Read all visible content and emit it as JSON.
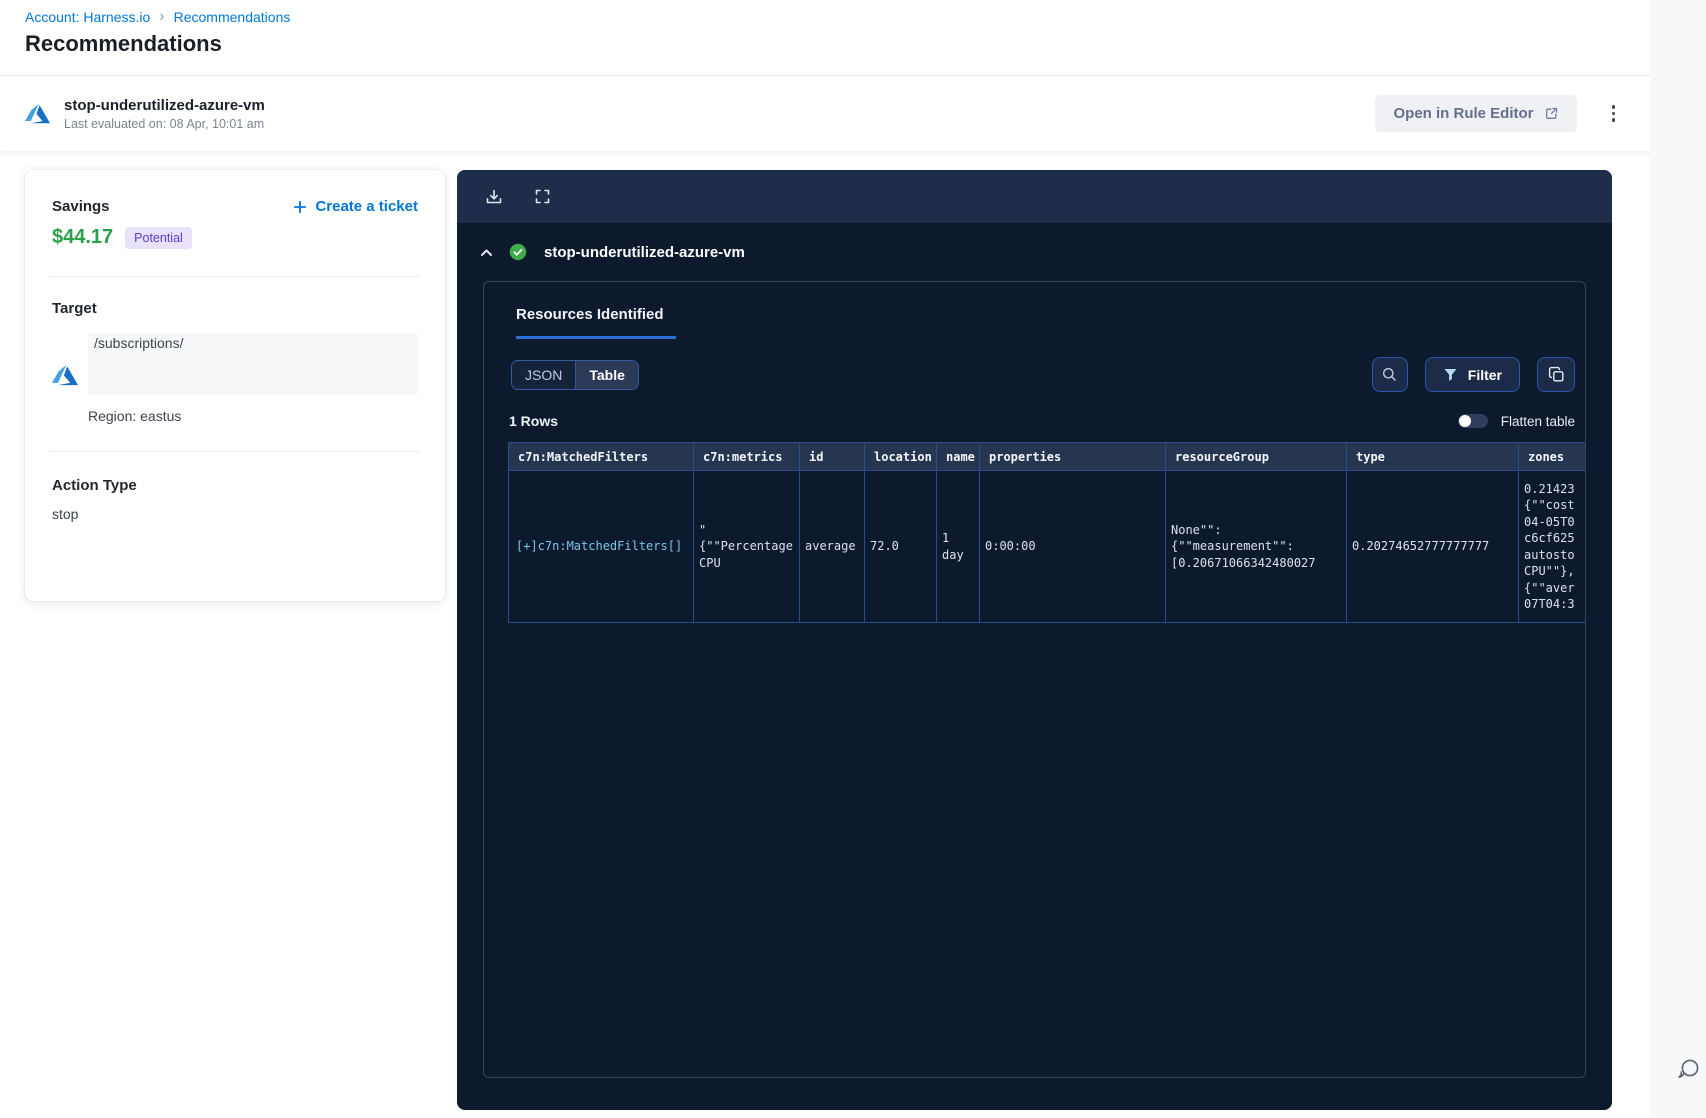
{
  "colors": {
    "accent_blue": "#0278d5",
    "savings_green": "#2aa04a",
    "badge_purple_bg": "#e8e3fb",
    "badge_purple_text": "#5c3bc9",
    "panel_bg": "#0d1a2e",
    "table_border_blue": "#2b4c8c",
    "table_link_cyan": "#7cc6e8",
    "tab_underline_blue": "#2b6fd4"
  },
  "icons": [
    "azure-icon",
    "kebab-menu-icon",
    "external-link-icon",
    "plus-icon",
    "download-icon",
    "fullscreen-icon",
    "chevron-up-icon",
    "check-circle-icon",
    "search-icon",
    "filter-funnel-icon",
    "copy-icon",
    "chat-bubble-icon",
    "breadcrumb-separator"
  ],
  "breadcrumb": {
    "account_link": "Account: Harness.io",
    "separator": "›",
    "current": "Recommendations"
  },
  "page_title": "Recommendations",
  "recommendation_header": {
    "name": "stop-underutilized-azure-vm",
    "last_evaluated": "Last evaluated on: 08 Apr, 10:01 am",
    "open_rule_editor": "Open in Rule Editor"
  },
  "summary_card": {
    "savings_label": "Savings",
    "savings_amount": "$44.17",
    "savings_badge": "Potential",
    "create_ticket": "Create a ticket",
    "target_label": "Target",
    "target_path": "/subscriptions/",
    "region": "Region: eastus",
    "action_type_label": "Action Type",
    "action_type_value": "stop"
  },
  "panel": {
    "title": "stop-underutilized-azure-vm",
    "tab_label": "Resources Identified",
    "json_label": "JSON",
    "table_label": "Table",
    "filter_label": "Filter",
    "rows_label": "1 Rows",
    "flatten_label": "Flatten table",
    "table": {
      "columns": [
        "c7n:MatchedFilters",
        "c7n:metrics",
        "id",
        "location",
        "name",
        "properties",
        "resourceGroup",
        "type",
        "zones"
      ],
      "row": {
        "matched_filters": "[+]c7n:MatchedFilters[]",
        "metrics": "\"\n{\"\"Percentage\nCPU",
        "id": "average",
        "location": "72.0",
        "name": "1\nday",
        "properties": "0:00:00",
        "resource_group": "None\"\":\n{\"\"measurement\"\":\n[0.20671066342480027",
        "type": "0.20274652777777777",
        "zones": "0.21423\n{\"\"cost\n04-05T0\nc6cf625\nautosto\nCPU\"\"},\n{\"\"aver\n07T04:3"
      }
    }
  }
}
